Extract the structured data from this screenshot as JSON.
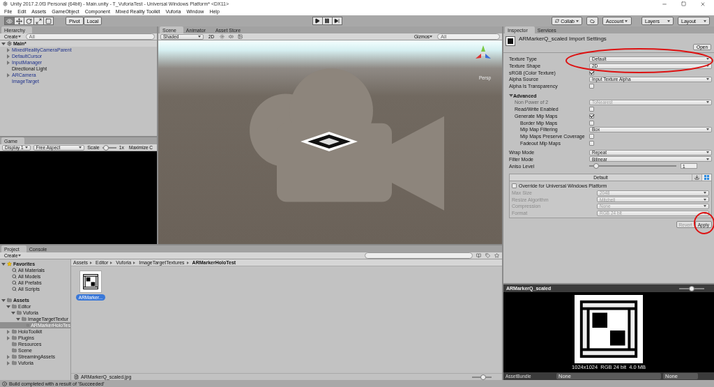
{
  "window": {
    "title": "Unity 2017.2.0f3 Personal (64bit) - Main.unity - T_VuforiaTest - Universal Windows Platform* <DX11>"
  },
  "menu": [
    "File",
    "Edit",
    "Assets",
    "GameObject",
    "Component",
    "Mixed Reality Toolkit",
    "Vuforia",
    "Window",
    "Help"
  ],
  "toolbar": {
    "tools": [
      {
        "kind": "view",
        "selected": true
      },
      {
        "kind": "move",
        "selected": false
      },
      {
        "kind": "rotate",
        "selected": false
      },
      {
        "kind": "scale",
        "selected": false
      },
      {
        "kind": "rect",
        "selected": false
      }
    ],
    "pivot": "Pivot",
    "local": "Local",
    "collab": "Collab",
    "account": "Account",
    "layers": "Layers",
    "layout": "Layout"
  },
  "hierarchy": {
    "tabs": [
      {
        "label": "Hierarchy",
        "selected": true
      }
    ],
    "create": "Create",
    "placeholder": "All",
    "scene": {
      "label": "Main*",
      "expanded": true
    },
    "items": [
      {
        "label": "MixedRealityCameraParent",
        "prefab": true,
        "expanded": false
      },
      {
        "label": "DefaultCursor",
        "prefab": true,
        "expanded": false
      },
      {
        "label": "InputManager",
        "prefab": true,
        "expanded": false
      },
      {
        "label": "Directional Light",
        "prefab": false
      },
      {
        "label": "ARCamera",
        "prefab": true,
        "expanded": false
      },
      {
        "label": "ImageTarget",
        "prefab": true
      }
    ]
  },
  "scene": {
    "tabs": [
      {
        "label": "Scene",
        "selected": true
      },
      {
        "label": "Animator",
        "selected": false
      },
      {
        "label": "Asset Store",
        "selected": false
      }
    ],
    "shading": "Shaded",
    "mode_2d": "2D",
    "gizmos": "Gizmos",
    "placeholder": "All",
    "projection": "Persp"
  },
  "game": {
    "tabs": [
      {
        "label": "Game",
        "selected": true
      }
    ],
    "display": "Display 1",
    "aspect": "Free Aspect",
    "scale_label": "Scale",
    "scale": {
      "level": 0.1
    },
    "scale_value": "1x",
    "maximize": "Maximize C"
  },
  "inspector": {
    "tabs": [
      {
        "label": "Inspector",
        "selected": true
      },
      {
        "label": "Services",
        "selected": false
      }
    ],
    "title": "ARMarkerQ_scaled Import Settings",
    "open": "Open",
    "rows": [
      {
        "kind": "dropdown",
        "label": "Texture Type",
        "value": "Default",
        "disabled": false
      },
      {
        "kind": "dropdown",
        "label": "Texture Shape",
        "value": "2D",
        "disabled": false
      },
      {
        "kind": "checkbox",
        "label": "sRGB (Color Texture)",
        "checked": true,
        "disabled": false
      },
      {
        "kind": "dropdown",
        "label": "Alpha Source",
        "value": "Input Texture Alpha",
        "disabled": false
      },
      {
        "kind": "checkbox",
        "label": "Alpha Is Transparency",
        "checked": false,
        "disabled": false
      },
      {
        "kind": "section",
        "label": "Advanced",
        "expanded": true,
        "children": [
          {
            "kind": "dropdown",
            "label": "Non Power of 2",
            "value": "ToNearest",
            "disabled": true
          },
          {
            "kind": "checkbox",
            "label": "Read/Write Enabled",
            "checked": false,
            "disabled": false
          },
          {
            "kind": "checkbox",
            "label": "Generate Mip Maps",
            "checked": true,
            "disabled": false,
            "children": [
              {
                "kind": "checkbox",
                "label": "Border Mip Maps",
                "checked": false,
                "disabled": false
              },
              {
                "kind": "dropdown",
                "label": "Mip Map Filtering",
                "value": "Box",
                "disabled": false
              },
              {
                "kind": "checkbox",
                "label": "Mip Maps Preserve Coverage",
                "checked": false,
                "disabled": false
              },
              {
                "kind": "checkbox",
                "label": "Fadeout Mip Maps",
                "checked": false,
                "disabled": false
              }
            ]
          }
        ]
      },
      {
        "kind": "dropdown",
        "label": "Wrap Mode",
        "value": "Repeat",
        "disabled": false
      },
      {
        "kind": "dropdown",
        "label": "Filter Mode",
        "value": "Bilinear",
        "disabled": false
      },
      {
        "kind": "slider",
        "label": "Aniso Level",
        "level": 0.05,
        "value": "1",
        "disabled": false
      }
    ],
    "platform": {
      "header": "Default",
      "tabs": [
        {
          "kind": "download",
          "selected": false
        },
        {
          "kind": "windows",
          "selected": true
        }
      ],
      "override": {
        "label": "Override for Universal Windows Platform",
        "checked": false
      },
      "rows": [
        {
          "label": "Max Size",
          "value": "2048"
        },
        {
          "label": "Resize Algorithm",
          "value": "Mitchell"
        },
        {
          "label": "Compression",
          "value": "None"
        },
        {
          "label": "Format",
          "value": "RGB 24 bit"
        }
      ]
    },
    "buttons": [
      {
        "label": "Revert",
        "disabled": true
      },
      {
        "label": "Apply",
        "disabled": false
      }
    ]
  },
  "preview": {
    "title": "ARMarkerQ_scaled",
    "slider": {
      "level": 0.5
    },
    "caption": "1024x1024  RGB 24 bit  4.0 MB",
    "assetbundle": "AssetBundle",
    "bundle_values": [
      "None",
      "None"
    ]
  },
  "project": {
    "tabs": [
      {
        "label": "Project",
        "selected": true
      },
      {
        "label": "Console",
        "selected": false
      }
    ],
    "create": "Create",
    "favorites": {
      "label": "Favorites",
      "expanded": true,
      "children": [
        {
          "label": "All Materials"
        },
        {
          "label": "All Models"
        },
        {
          "label": "All Prefabs"
        },
        {
          "label": "All Scripts"
        }
      ]
    },
    "assets": {
      "label": "Assets",
      "expanded": true,
      "children": [
        {
          "label": "Editor",
          "expanded": true,
          "selected": false,
          "children": [
            {
              "label": "Vuforia",
              "expanded": true,
              "selected": false,
              "children": [
                {
                  "label": "ImageTargetTextur",
                  "expanded": true,
                  "selected": false,
                  "children": [
                    {
                      "label": "ARMarkerHoloTes",
                      "selected": true
                    }
                  ]
                }
              ]
            }
          ]
        },
        {
          "label": "HoloToolkit",
          "expanded": false,
          "selected": false
        },
        {
          "label": "Plugins",
          "expanded": false,
          "selected": false
        },
        {
          "label": "Resources",
          "selected": false
        },
        {
          "label": "Scene",
          "selected": false
        },
        {
          "label": "StreamingAssets",
          "expanded": false,
          "selected": false
        },
        {
          "label": "Vuforia",
          "expanded": false,
          "selected": false
        }
      ]
    },
    "breadcrumb": [
      "Assets",
      "Editor",
      "Vuforia",
      "ImageTargetTextures",
      "ARMarkerHoloTest"
    ],
    "files": [
      {
        "label": "ARMarker...",
        "selected": true
      }
    ],
    "footer": "ARMarkerQ_scaled.jpg",
    "zoom": {
      "level": 0.6
    }
  },
  "status": "Build completed with a result of 'Succeeded'"
}
